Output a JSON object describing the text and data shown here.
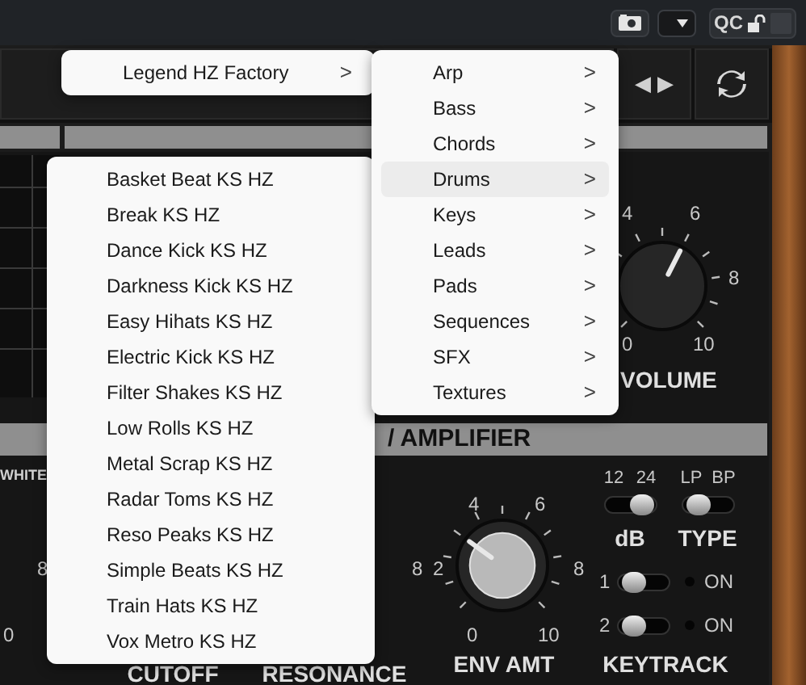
{
  "top_bar": {
    "qc_label": "QC",
    "locked": false
  },
  "transport": {
    "prev": "◀",
    "next": "▶"
  },
  "volume_knob": {
    "label": "VOLUME",
    "level": 0.6,
    "scale": [
      "4",
      "6",
      "8",
      "0",
      "10"
    ]
  },
  "amp_section": {
    "title": "/ AMPLIFIER"
  },
  "left_knob": {
    "label": "WHITE",
    "scale": [
      "8",
      "0"
    ]
  },
  "resonance_scale": [
    "8"
  ],
  "env_knob": {
    "label": "ENV AMT",
    "level": 0.3,
    "scale": [
      "4",
      "6",
      "2",
      "8",
      "0",
      "10"
    ]
  },
  "filter_labels": [
    "CUTOFF",
    "RESONANCE"
  ],
  "switches": [
    {
      "label": "dB",
      "options": [
        "12",
        "24"
      ],
      "on": true
    },
    {
      "label": "TYPE",
      "options": [
        "LP",
        "BP"
      ],
      "on": false
    }
  ],
  "keytrack": {
    "label": "KEYTRACK",
    "rows": [
      {
        "number": "1",
        "on": false,
        "on_label": "ON",
        "lit": false
      },
      {
        "number": "2",
        "on": false,
        "on_label": "ON",
        "lit": false
      }
    ]
  },
  "menu_root": {
    "items": [
      {
        "label": "Legend HZ Factory",
        "arrow": ">"
      }
    ]
  },
  "menu_categories": {
    "items": [
      {
        "label": "Arp",
        "arrow": ">",
        "selected": false
      },
      {
        "label": "Bass",
        "arrow": ">",
        "selected": false
      },
      {
        "label": "Chords",
        "arrow": ">",
        "selected": false
      },
      {
        "label": "Drums",
        "arrow": ">",
        "selected": true
      },
      {
        "label": "Keys",
        "arrow": ">",
        "selected": false
      },
      {
        "label": "Leads",
        "arrow": ">",
        "selected": false
      },
      {
        "label": "Pads",
        "arrow": ">",
        "selected": false
      },
      {
        "label": "Sequences",
        "arrow": ">",
        "selected": false
      },
      {
        "label": "SFX",
        "arrow": ">",
        "selected": false
      },
      {
        "label": "Textures",
        "arrow": ">",
        "selected": false
      }
    ]
  },
  "menu_presets": {
    "items": [
      "Basket Beat KS HZ",
      "Break KS HZ",
      "Dance Kick KS HZ",
      "Darkness Kick KS HZ",
      "Easy Hihats KS HZ",
      "Electric Kick KS HZ",
      "Filter Shakes KS HZ",
      "Low Rolls KS HZ",
      "Metal Scrap KS HZ",
      "Radar Toms KS HZ",
      "Reso Peaks KS HZ",
      "Simple Beats KS HZ",
      "Train Hats KS HZ",
      "Vox Metro KS HZ"
    ]
  }
}
